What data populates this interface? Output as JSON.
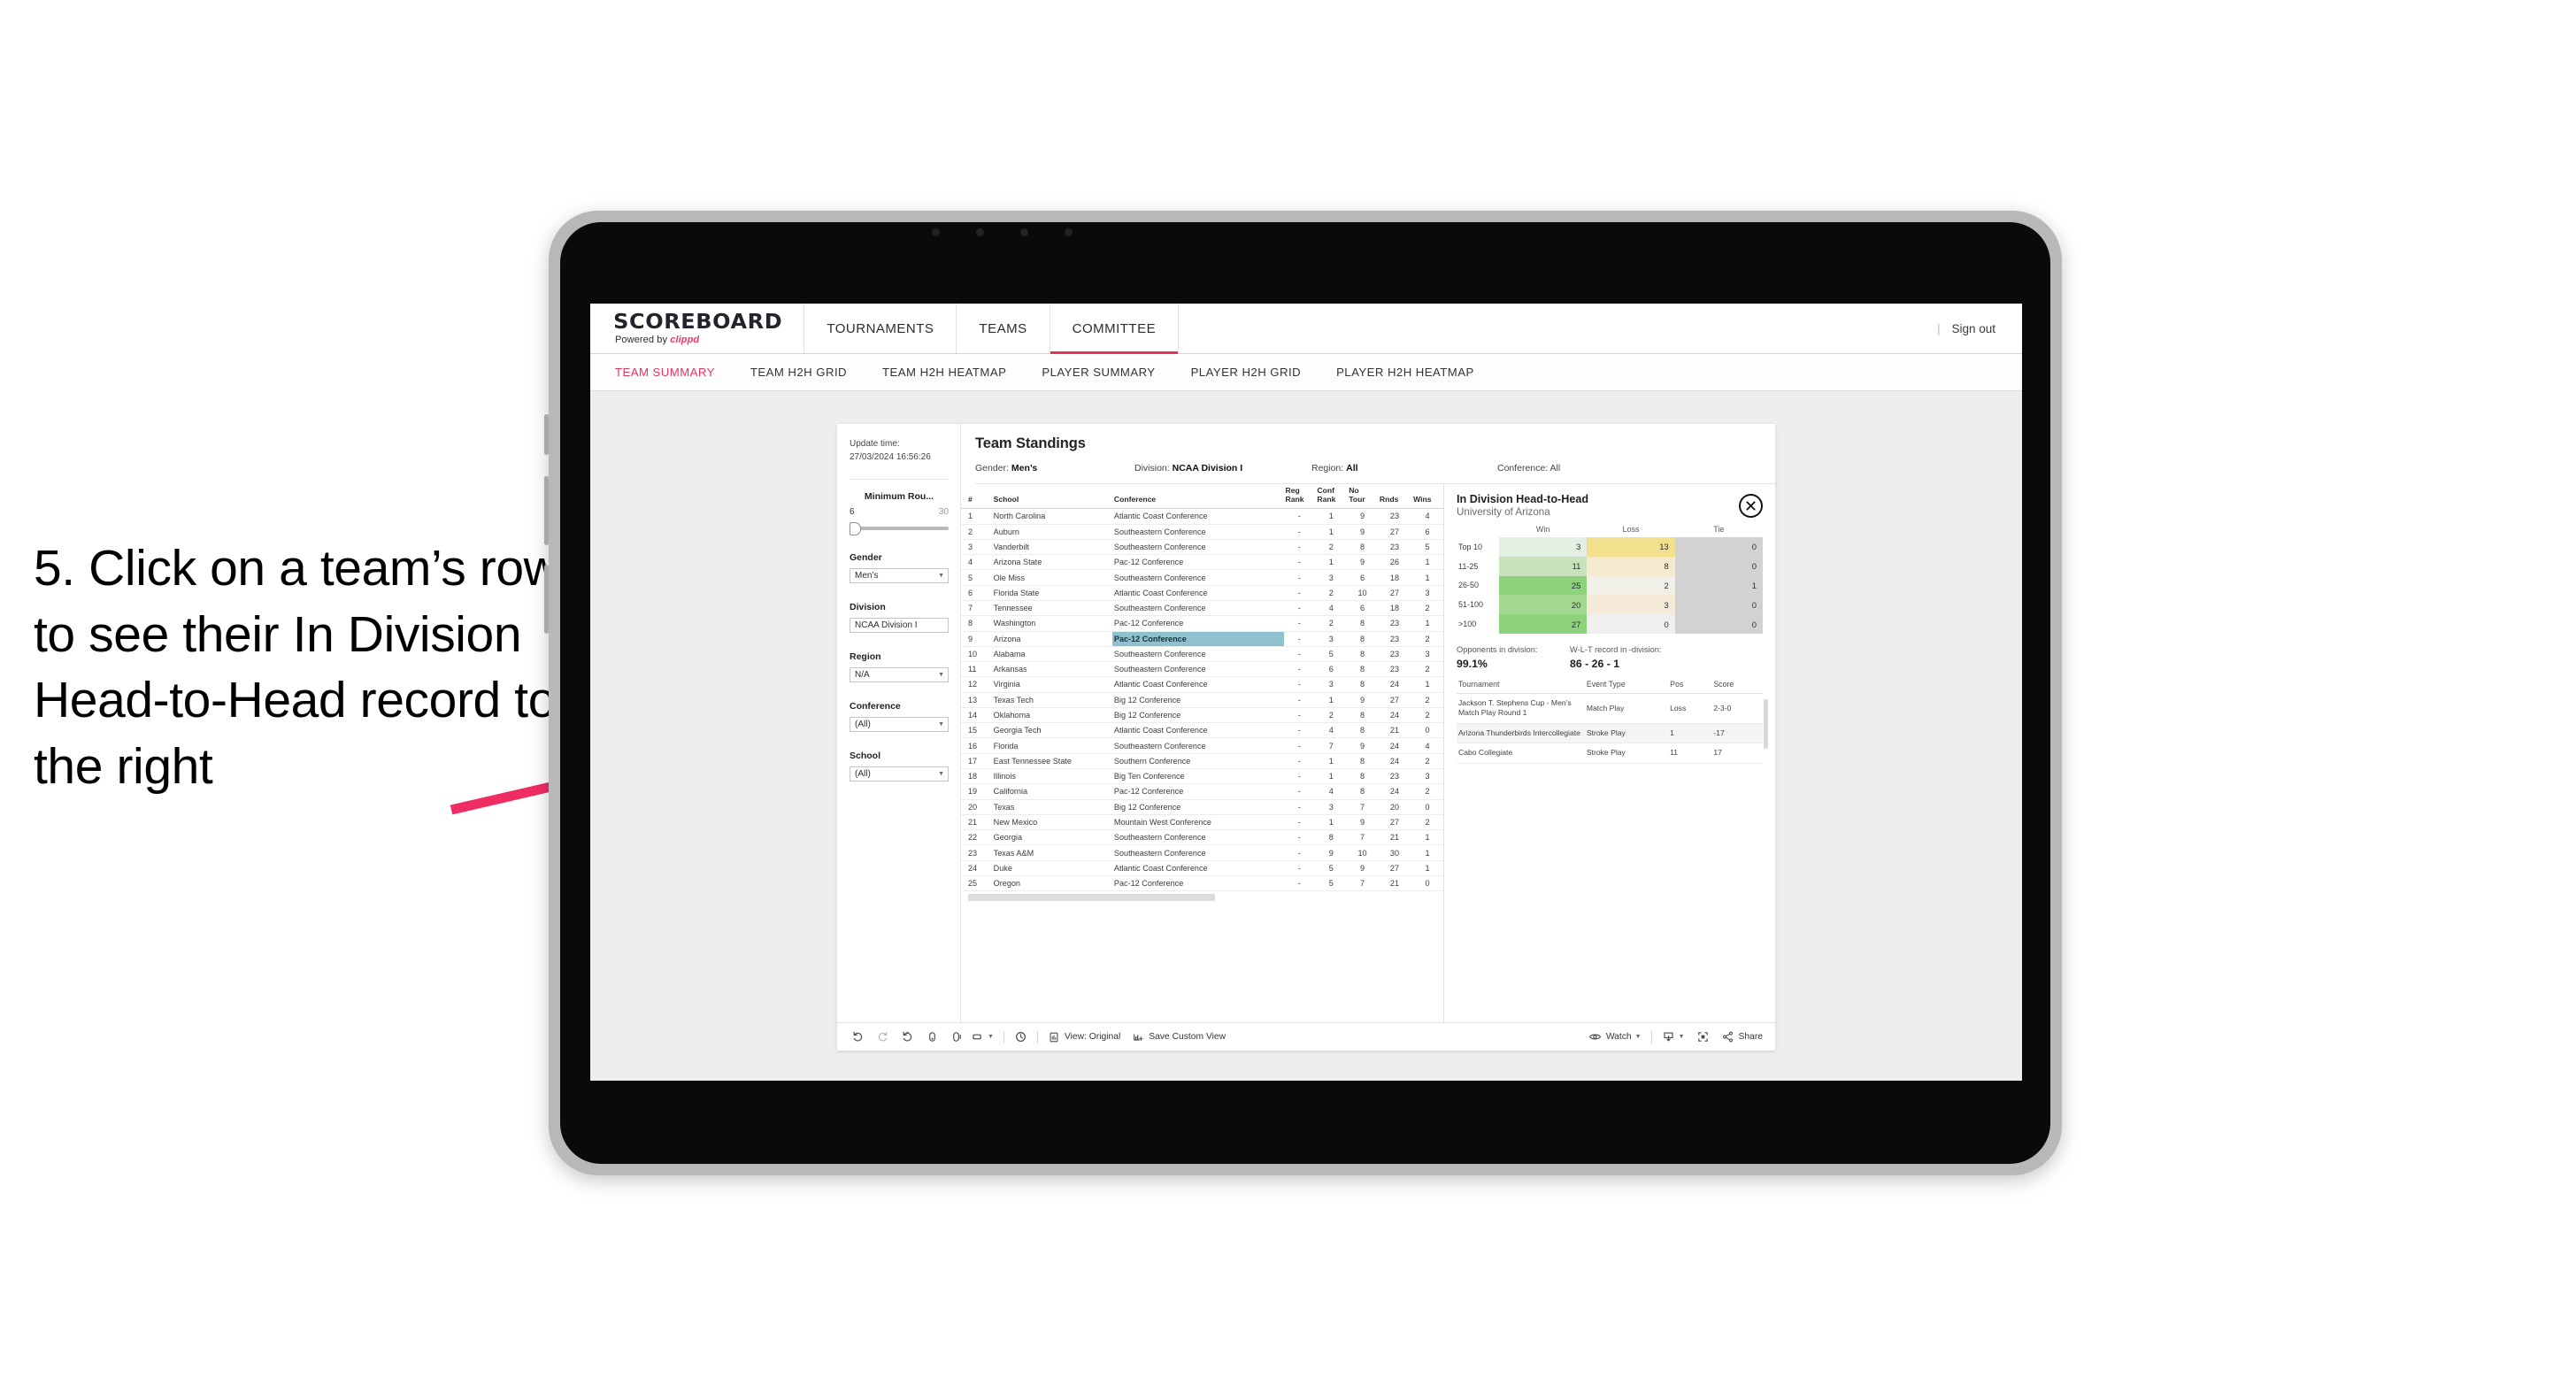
{
  "annotation": {
    "text": "5. Click on a team’s row to see their In Division Head-to-Head record to the right",
    "arrow_color": "#ef2d63"
  },
  "topnav": {
    "logo_main": "SCOREBOARD",
    "logo_sub_prefix": "Powered by ",
    "logo_brand": "clippd",
    "items": [
      {
        "label": "TOURNAMENTS",
        "active": false
      },
      {
        "label": "TEAMS",
        "active": false
      },
      {
        "label": "COMMITTEE",
        "active": true
      }
    ],
    "divider": "|",
    "signout": "Sign out",
    "accent": "#e8345c"
  },
  "subnav": {
    "items": [
      {
        "label": "TEAM SUMMARY",
        "active": true
      },
      {
        "label": "TEAM H2H GRID",
        "active": false
      },
      {
        "label": "TEAM H2H HEATMAP",
        "active": false
      },
      {
        "label": "PLAYER SUMMARY",
        "active": false
      },
      {
        "label": "PLAYER H2H GRID",
        "active": false
      },
      {
        "label": "PLAYER H2H HEATMAP",
        "active": false
      }
    ]
  },
  "filters": {
    "update_time_label": "Update time:",
    "update_time_value": "27/03/2024 16:56:26",
    "min_rounds": {
      "title": "Minimum Rou...",
      "low": "6",
      "high": "30"
    },
    "controls": [
      {
        "title": "Gender",
        "value": "Men’s"
      },
      {
        "title": "Division",
        "value": "NCAA Division I"
      },
      {
        "title": "Region",
        "value": "N/A"
      },
      {
        "title": "Conference",
        "value": "(All)"
      },
      {
        "title": "School",
        "value": "(All)"
      }
    ]
  },
  "main": {
    "title": "Team Standings",
    "summary": [
      {
        "label": "Gender: ",
        "value": "Men’s"
      },
      {
        "label": "Division: ",
        "value": "NCAA Division I"
      },
      {
        "label": "Region: ",
        "value": "All"
      },
      {
        "label": "Conference: ",
        "value": "All"
      }
    ]
  },
  "standings": {
    "columns": [
      "#",
      "School",
      "Conference",
      "Reg Rank",
      "Conf Rank",
      "No Tour",
      "Rnds",
      "Wins"
    ],
    "selected_row": 9,
    "rows": [
      {
        "num": "1",
        "school": "North Carolina",
        "conf": "Atlantic Coast Conference",
        "reg": "-",
        "cr": "1",
        "nt": "9",
        "rn": "23",
        "wn": "4"
      },
      {
        "num": "2",
        "school": "Auburn",
        "conf": "Southeastern Conference",
        "reg": "-",
        "cr": "1",
        "nt": "9",
        "rn": "27",
        "wn": "6"
      },
      {
        "num": "3",
        "school": "Vanderbilt",
        "conf": "Southeastern Conference",
        "reg": "-",
        "cr": "2",
        "nt": "8",
        "rn": "23",
        "wn": "5"
      },
      {
        "num": "4",
        "school": "Arizona State",
        "conf": "Pac-12 Conference",
        "reg": "-",
        "cr": "1",
        "nt": "9",
        "rn": "26",
        "wn": "1"
      },
      {
        "num": "5",
        "school": "Ole Miss",
        "conf": "Southeastern Conference",
        "reg": "-",
        "cr": "3",
        "nt": "6",
        "rn": "18",
        "wn": "1"
      },
      {
        "num": "6",
        "school": "Florida State",
        "conf": "Atlantic Coast Conference",
        "reg": "-",
        "cr": "2",
        "nt": "10",
        "rn": "27",
        "wn": "3"
      },
      {
        "num": "7",
        "school": "Tennessee",
        "conf": "Southeastern Conference",
        "reg": "-",
        "cr": "4",
        "nt": "6",
        "rn": "18",
        "wn": "2"
      },
      {
        "num": "8",
        "school": "Washington",
        "conf": "Pac-12 Conference",
        "reg": "-",
        "cr": "2",
        "nt": "8",
        "rn": "23",
        "wn": "1"
      },
      {
        "num": "9",
        "school": "Arizona",
        "conf": "Pac-12 Conference",
        "reg": "-",
        "cr": "3",
        "nt": "8",
        "rn": "23",
        "wn": "2"
      },
      {
        "num": "10",
        "school": "Alabama",
        "conf": "Southeastern Conference",
        "reg": "-",
        "cr": "5",
        "nt": "8",
        "rn": "23",
        "wn": "3"
      },
      {
        "num": "11",
        "school": "Arkansas",
        "conf": "Southeastern Conference",
        "reg": "-",
        "cr": "6",
        "nt": "8",
        "rn": "23",
        "wn": "2"
      },
      {
        "num": "12",
        "school": "Virginia",
        "conf": "Atlantic Coast Conference",
        "reg": "-",
        "cr": "3",
        "nt": "8",
        "rn": "24",
        "wn": "1"
      },
      {
        "num": "13",
        "school": "Texas Tech",
        "conf": "Big 12 Conference",
        "reg": "-",
        "cr": "1",
        "nt": "9",
        "rn": "27",
        "wn": "2"
      },
      {
        "num": "14",
        "school": "Oklahoma",
        "conf": "Big 12 Conference",
        "reg": "-",
        "cr": "2",
        "nt": "8",
        "rn": "24",
        "wn": "2"
      },
      {
        "num": "15",
        "school": "Georgia Tech",
        "conf": "Atlantic Coast Conference",
        "reg": "-",
        "cr": "4",
        "nt": "8",
        "rn": "21",
        "wn": "0"
      },
      {
        "num": "16",
        "school": "Florida",
        "conf": "Southeastern Conference",
        "reg": "-",
        "cr": "7",
        "nt": "9",
        "rn": "24",
        "wn": "4"
      },
      {
        "num": "17",
        "school": "East Tennessee State",
        "conf": "Southern Conference",
        "reg": "-",
        "cr": "1",
        "nt": "8",
        "rn": "24",
        "wn": "2"
      },
      {
        "num": "18",
        "school": "Illinois",
        "conf": "Big Ten Conference",
        "reg": "-",
        "cr": "1",
        "nt": "8",
        "rn": "23",
        "wn": "3"
      },
      {
        "num": "19",
        "school": "California",
        "conf": "Pac-12 Conference",
        "reg": "-",
        "cr": "4",
        "nt": "8",
        "rn": "24",
        "wn": "2"
      },
      {
        "num": "20",
        "school": "Texas",
        "conf": "Big 12 Conference",
        "reg": "-",
        "cr": "3",
        "nt": "7",
        "rn": "20",
        "wn": "0"
      },
      {
        "num": "21",
        "school": "New Mexico",
        "conf": "Mountain West Conference",
        "reg": "-",
        "cr": "1",
        "nt": "9",
        "rn": "27",
        "wn": "2"
      },
      {
        "num": "22",
        "school": "Georgia",
        "conf": "Southeastern Conference",
        "reg": "-",
        "cr": "8",
        "nt": "7",
        "rn": "21",
        "wn": "1"
      },
      {
        "num": "23",
        "school": "Texas A&M",
        "conf": "Southeastern Conference",
        "reg": "-",
        "cr": "9",
        "nt": "10",
        "rn": "30",
        "wn": "1"
      },
      {
        "num": "24",
        "school": "Duke",
        "conf": "Atlantic Coast Conference",
        "reg": "-",
        "cr": "5",
        "nt": "9",
        "rn": "27",
        "wn": "1"
      },
      {
        "num": "25",
        "school": "Oregon",
        "conf": "Pac-12 Conference",
        "reg": "-",
        "cr": "5",
        "nt": "7",
        "rn": "21",
        "wn": "0"
      }
    ]
  },
  "h2h": {
    "title": "In Division Head-to-Head",
    "subtitle": "University of Arizona",
    "close_icon": "close-circle-icon",
    "chart_data": {
      "type": "heatmap",
      "title": "In Division Head-to-Head",
      "subtitle": "University of Arizona",
      "columns": [
        "Win",
        "Loss",
        "Tie"
      ],
      "rows": [
        "Top 10",
        "11-25",
        "26-50",
        "51-100",
        ">100"
      ],
      "values": [
        [
          3,
          13,
          0
        ],
        [
          11,
          8,
          0
        ],
        [
          25,
          2,
          1
        ],
        [
          20,
          3,
          0
        ],
        [
          27,
          0,
          0
        ]
      ],
      "cell_colors": [
        [
          "#e4efe3",
          "#f2e08f",
          "#d2d2d2"
        ],
        [
          "#c8e3bc",
          "#f5ead0",
          "#d2d2d2"
        ],
        [
          "#8ed27c",
          "#f1f0e8",
          "#d2d2d2"
        ],
        [
          "#a2d88f",
          "#f5ead8",
          "#d2d2d2"
        ],
        [
          "#8ed27c",
          "#efefef",
          "#d2d2d2"
        ]
      ]
    },
    "stats": [
      {
        "label": "Opponents in division:",
        "value": "99.1%"
      },
      {
        "label": "W-L-T record in -division:",
        "value": "86 - 26 - 1"
      }
    ],
    "tournaments": {
      "columns": [
        "Tournament",
        "Event Type",
        "Pos",
        "Score"
      ],
      "rows": [
        {
          "name": "Jackson T. Stephens Cup - Men’s Match Play Round 1",
          "type": "Match Play",
          "pos": "Loss",
          "score": "2-3-0"
        },
        {
          "name": "Arizona Thunderbirds Intercollegiate",
          "type": "Stroke Play",
          "pos": "1",
          "score": "-17"
        },
        {
          "name": "Cabo Collegiate",
          "type": "Stroke Play",
          "pos": "11",
          "score": "17"
        }
      ]
    }
  },
  "toolbar": {
    "icons_left": [
      "undo-icon",
      "redo-icon",
      "revert-icon",
      "refresh-icon",
      "pause-icon",
      "rectangle-select-icon"
    ],
    "clock_icon": "clock-icon",
    "view_label": "View: Original",
    "view_icon": "view-original-icon",
    "save_label": "Save Custom View",
    "save_icon": "save-view-icon",
    "watch_label": "Watch",
    "watch_icon": "eye-icon",
    "download_icon": "download-icon",
    "fullscreen_icon": "fullscreen-icon",
    "share_label": "Share",
    "share_icon": "share-icon"
  }
}
